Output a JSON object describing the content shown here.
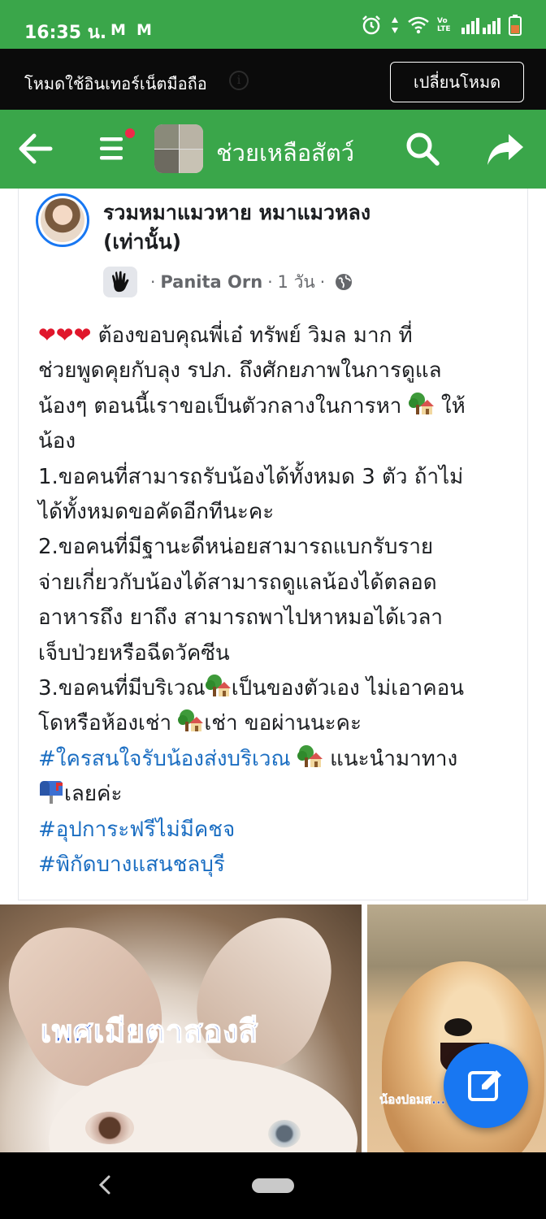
{
  "status_bar": {
    "time": "16:35 น.",
    "mail_icons": [
      "M",
      "M"
    ],
    "right_icons": [
      "alarm-icon",
      "data-arrows-icon",
      "wifi-icon",
      "volte-icon",
      "signal-icon",
      "battery-icon"
    ],
    "volte_label": "Vo LTE",
    "background": "#3aa64a"
  },
  "data_banner": {
    "text": "โหมดใช้อินเทอร์เน็ตมือถือ",
    "info_icon": "i",
    "button_label": "เปลี่ยนโหมด"
  },
  "app_bar": {
    "group_name": "ช่วยเหลือสัตว์",
    "icons": [
      "back-arrow-icon",
      "menu-icon",
      "search-icon",
      "share-icon"
    ],
    "has_notification_dot": true
  },
  "post": {
    "group_title_line1": "รวมหมาแมวหาย หมาแมวหลง",
    "group_title_line2": "(เท่านั้น)",
    "separator": "·",
    "author": "Panita Orn",
    "time": "1 วัน",
    "privacy_icon": "globe-icon",
    "hearts": "❤❤❤",
    "body": {
      "l1_rest": " ต้องขอบคุณพี่เอ๋ ทรัพย์ วิมล มาก ที่",
      "l2": "ช่วยพูดคุยกับลุง รปภ. ถึงศักยภาพในการดูแล",
      "l3_a": "น้องๆ ตอนนี้เราขอเป็นตัวกลางในการหา ",
      "l3_b": " ให้",
      "l4": "น้อง",
      "l5": "1.ขอคนที่สามารถรับน้องได้ทั้งหมด 3 ตัว ถ้าไม่",
      "l6": "ได้ทั้งหมดขอคัดอีกทีนะคะ",
      "l7": "2.ขอคนที่มีฐานะดีหน่อยสามารถแบกรับราย",
      "l8": "จ่ายเกี่ยวกับน้องได้สามารถดูแลน้องได้ตลอด",
      "l9": "อาหารถึง ยาถึง สามารถพาไปหาหมอได้เวลา",
      "l10": "เจ็บป่วยหรือฉีดวัคซีน",
      "l11_a": "3.ขอคนที่มีบริเวณ",
      "l11_b": "เป็นของตัวเอง ไม่เอาคอน",
      "l12_a": "โดหรือห้องเช่า ",
      "l12_b": "เช่า ขอผ่านนะคะ",
      "l13_hashtag": "#ใครสนใจรับน้องส่งบริเวณ ",
      "l13_rest": " แนะนำมาทาง",
      "l14_rest": "เลยค่ะ",
      "l15_hashtag": "#อุปการะฟรีไม่มีคชจ",
      "l16_hashtag": "#พิกัดบางแสนชลบุรี"
    },
    "emoji_names": [
      "house-with-garden-emoji",
      "mailbox-emoji"
    ],
    "photos": [
      {
        "caption": "เพศเมียตาสองสี",
        "alt": "white dog with two-colored eyes"
      },
      {
        "caption": "น้องปอมส...",
        "alt": "pomeranian dog"
      }
    ]
  },
  "colors": {
    "brand_green": "#3aa64a",
    "link_blue": "#1b6ec2",
    "fab_blue": "#1877f2",
    "meta_gray": "#65676b"
  },
  "fab": {
    "icon": "compose-icon"
  }
}
